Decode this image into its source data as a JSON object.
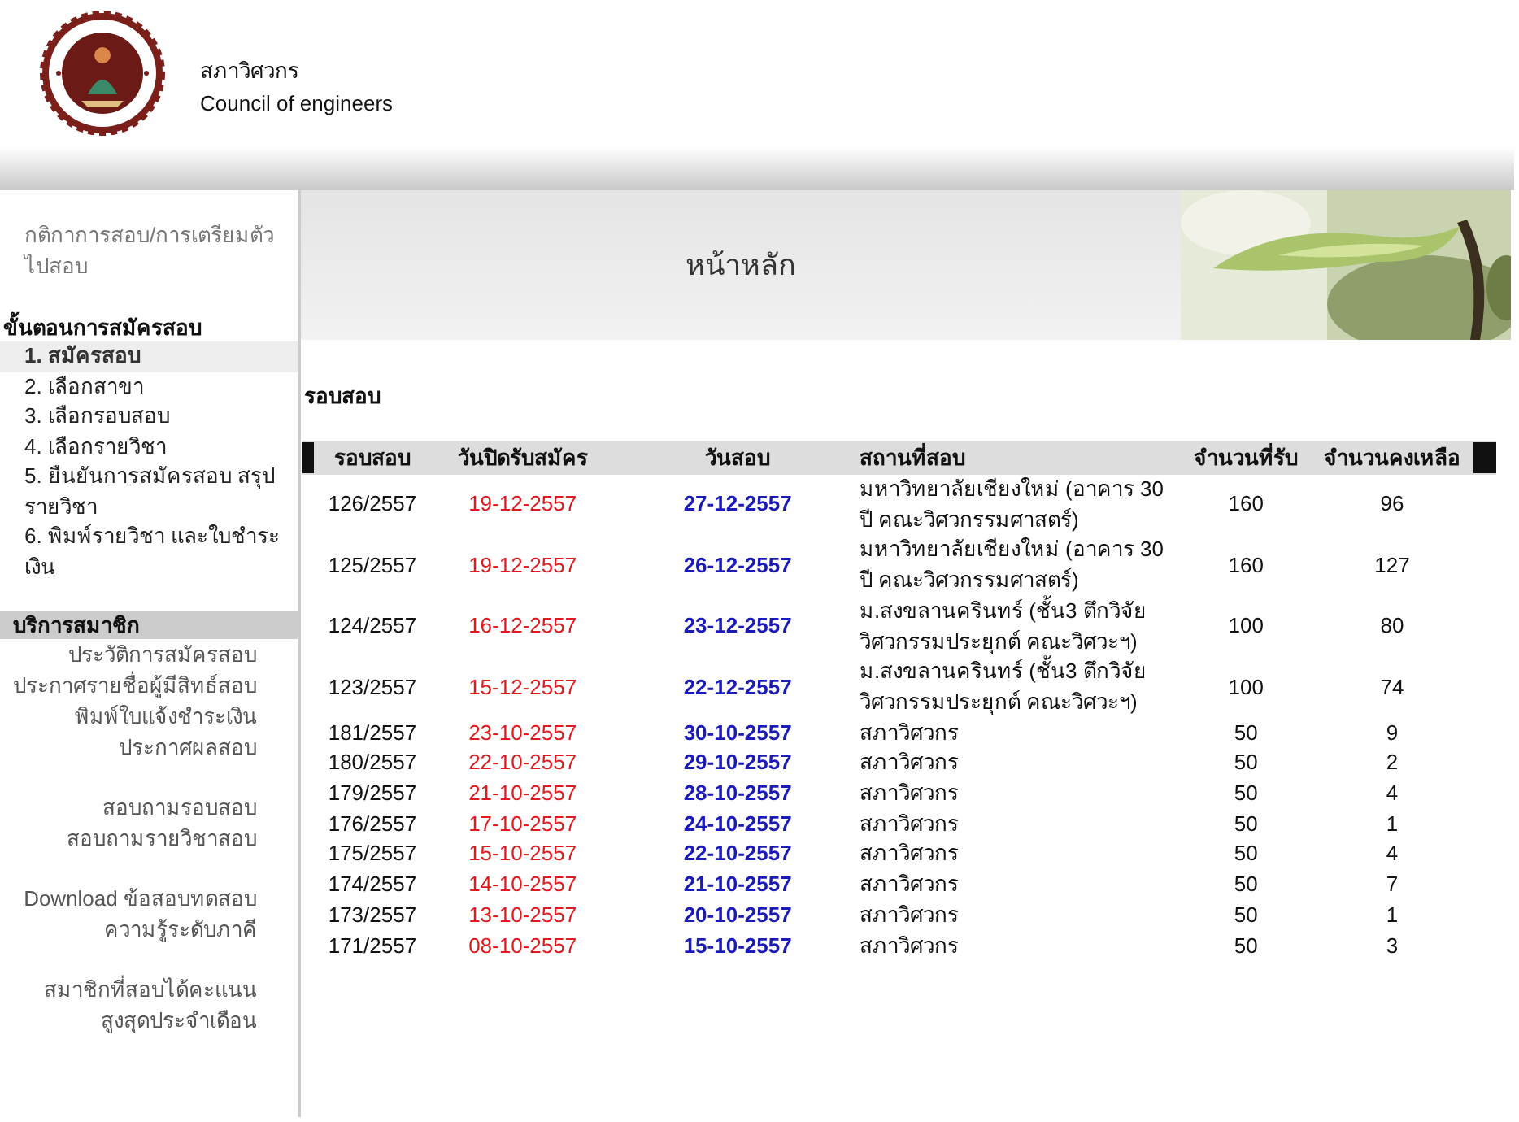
{
  "header": {
    "name_thai": "สภาวิศวกร",
    "name_english": "Council of engineers"
  },
  "sidebar": {
    "intro_link": "กติกาการสอบ/การเตรียมตัวไปสอบ",
    "steps_heading": "ขั้นตอนการสมัครสอบ",
    "steps": [
      {
        "label": "1. สมัครสอบ",
        "selected": true
      },
      {
        "label": "2. เลือกสาขา",
        "selected": false
      },
      {
        "label": "3. เลือกรอบสอบ",
        "selected": false
      },
      {
        "label": "4. เลือกรายวิชา",
        "selected": false
      },
      {
        "label": "5. ยืนยันการสมัครสอบ  สรุปรายวิชา",
        "selected": false
      },
      {
        "label": "6. พิมพ์รายวิชา  และใบชำระเงิน",
        "selected": false
      }
    ],
    "services_heading": "บริการสมาชิก",
    "service_groups": [
      [
        "ประวัติการสมัครสอบ",
        "ประกาศรายชื่อผู้มีสิทธ์สอบ",
        "พิมพ์ใบแจ้งชำระเงิน",
        "ประกาศผลสอบ"
      ],
      [
        "สอบถามรอบสอบ",
        "สอบถามรายวิชาสอบ"
      ],
      [
        "Download ข้อสอบทดสอบความรู้ระดับภาคี"
      ],
      [
        "สมาชิกที่สอบได้คะแนนสูงสุดประจำเดือน"
      ]
    ]
  },
  "banner": {
    "title": "หน้าหลัก",
    "kind": "picture"
  },
  "section_title": "รอบสอบ",
  "table": {
    "columns": [
      "รอบสอบ",
      "วันปิดรับสมัคร",
      "วันสอบ",
      "สถานที่สอบ",
      "จำนวนที่รับ",
      "จำนวนคงเหลือ"
    ],
    "rows": [
      [
        "126/2557",
        "19-12-2557",
        "27-12-2557",
        "มหาวิทยาลัยเชียงใหม่ (อาคาร  30 ปี  คณะวิศวกรรมศาสตร์)",
        "160",
        "96"
      ],
      [
        "125/2557",
        "19-12-2557",
        "26-12-2557",
        "มหาวิทยาลัยเชียงใหม่ (อาคาร  30 ปี  คณะวิศวกรรมศาสตร์)",
        "160",
        "127"
      ],
      [
        "124/2557",
        "16-12-2557",
        "23-12-2557",
        "ม.สงขลานครินทร์  (ชั้น3 ตึกวิจัยวิศวกรรมประยุกต์  คณะวิศวะฯ)",
        "100",
        "80"
      ],
      [
        "123/2557",
        "15-12-2557",
        "22-12-2557",
        "ม.สงขลานครินทร์  (ชั้น3 ตึกวิจัยวิศวกรรมประยุกต์  คณะวิศวะฯ)",
        "100",
        "74"
      ],
      [
        "181/2557",
        "23-10-2557",
        "30-10-2557",
        "สภาวิศวกร",
        "50",
        "9"
      ],
      [
        "180/2557",
        "22-10-2557",
        "29-10-2557",
        "สภาวิศวกร",
        "50",
        "2"
      ],
      [
        "179/2557",
        "21-10-2557",
        "28-10-2557",
        "สภาวิศวกร",
        "50",
        "4"
      ],
      [
        "176/2557",
        "17-10-2557",
        "24-10-2557",
        "สภาวิศวกร",
        "50",
        "1"
      ],
      [
        "175/2557",
        "15-10-2557",
        "22-10-2557",
        "สภาวิศวกร",
        "50",
        "4"
      ],
      [
        "174/2557",
        "14-10-2557",
        "21-10-2557",
        "สภาวิศวกร",
        "50",
        "7"
      ],
      [
        "173/2557",
        "13-10-2557",
        "20-10-2557",
        "สภาวิศวกร",
        "50",
        "1"
      ],
      [
        "171/2557",
        "08-10-2557",
        "15-10-2557",
        "สภาวิศวกร",
        "50",
        "3"
      ]
    ]
  }
}
